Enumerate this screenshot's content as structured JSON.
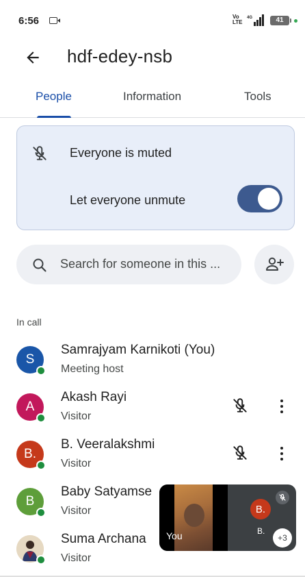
{
  "status_bar": {
    "time": "6:56",
    "volte": "Vo\nLTE",
    "network": "4G",
    "battery": "41"
  },
  "header": {
    "title": "hdf-edey-nsb"
  },
  "tabs": [
    {
      "label": "People",
      "active": true
    },
    {
      "label": "Information",
      "active": false
    },
    {
      "label": "Tools",
      "active": false
    }
  ],
  "mute_card": {
    "status_text": "Everyone is muted",
    "toggle_label": "Let everyone unmute",
    "toggle_on": true
  },
  "search": {
    "placeholder": "Search for someone in this ..."
  },
  "section": {
    "heading": "In call"
  },
  "participants": [
    {
      "initial": "S",
      "name": "Samrajyam Karnikoti (You)",
      "role": "Meeting host",
      "color": "#1a56a8",
      "muted": false
    },
    {
      "initial": "A",
      "name": "Akash Rayi",
      "role": "Visitor",
      "color": "#c2185b",
      "muted": true
    },
    {
      "initial": "B.",
      "name": "B. Veeralakshmi",
      "role": "Visitor",
      "color": "#c5391b",
      "muted": true
    },
    {
      "initial": "B",
      "name": "Baby Satyamse",
      "role": "Visitor",
      "color": "#5e9e3a",
      "muted": true
    },
    {
      "initial": "",
      "name": "Suma Archana",
      "role": "Visitor",
      "color": "#d9c6a5",
      "muted": true
    }
  ],
  "pip": {
    "self_label": "You",
    "other_initial": "B.",
    "other_name": "B.",
    "overflow_count": "+3"
  },
  "colors": {
    "accent": "#1a4ea8",
    "card_bg": "#e8eef9",
    "toggle": "#3d5a8f",
    "online": "#1e8e3e"
  }
}
